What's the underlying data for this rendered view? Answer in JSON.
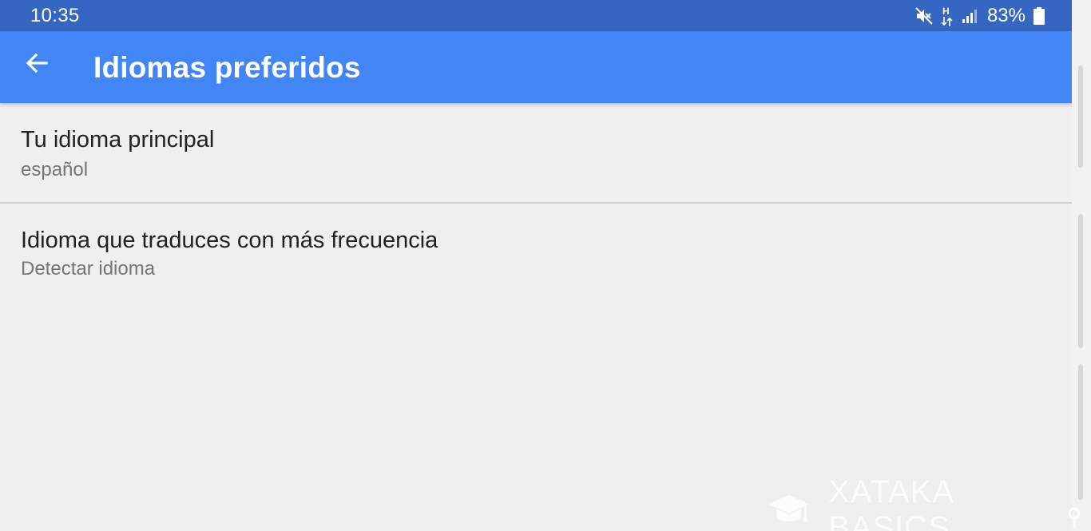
{
  "status_bar": {
    "time": "10:35",
    "network_label": "H",
    "battery_percent": "83%",
    "icons": [
      "mute-icon",
      "network-data-icon",
      "signal-icon",
      "battery-icon"
    ]
  },
  "app_bar": {
    "title": "Idiomas preferidos",
    "back_icon": "arrow-back-icon",
    "color": "#4285f4"
  },
  "settings": [
    {
      "title": "Tu idioma principal",
      "subtitle": "español"
    },
    {
      "title": "Idioma que traduces con más frecuencia",
      "subtitle": "Detectar idioma"
    }
  ],
  "watermark": {
    "text": "XATAKA BASICS",
    "icon": "graduation-cap-icon"
  },
  "colors": {
    "status_bar": "#3566c1",
    "app_bar": "#4285f4",
    "background": "#efefef"
  }
}
